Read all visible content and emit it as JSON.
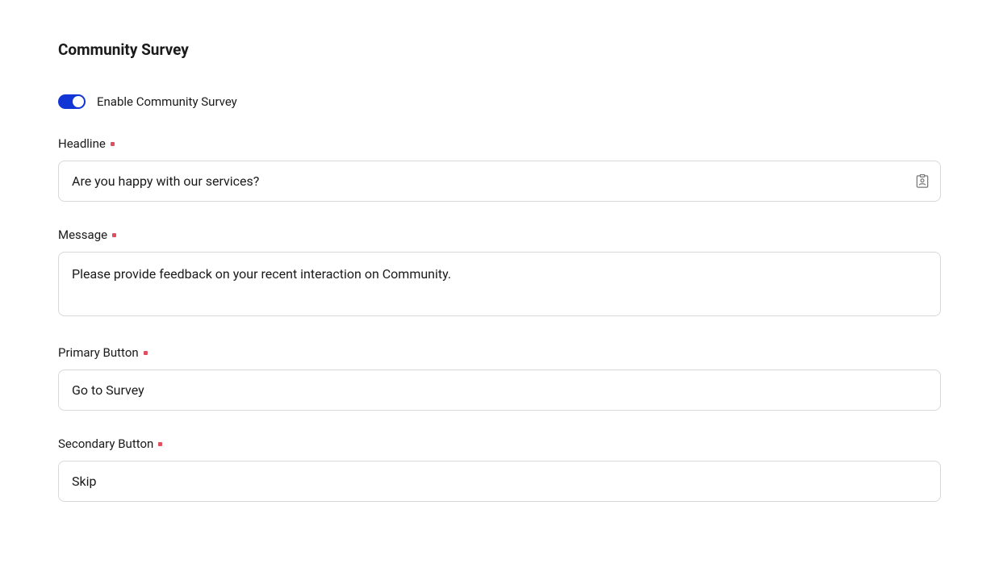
{
  "page": {
    "title": "Community Survey"
  },
  "toggle": {
    "label": "Enable Community Survey",
    "enabled": true
  },
  "fields": {
    "headline": {
      "label": "Headline",
      "value": "Are you happy with our services?",
      "required": true
    },
    "message": {
      "label": "Message",
      "value": "Please provide feedback on your recent interaction on Community.",
      "required": true
    },
    "primaryButton": {
      "label": "Primary Button",
      "value": "Go to Survey",
      "required": true
    },
    "secondaryButton": {
      "label": "Secondary Button",
      "value": "Skip",
      "required": true
    }
  }
}
